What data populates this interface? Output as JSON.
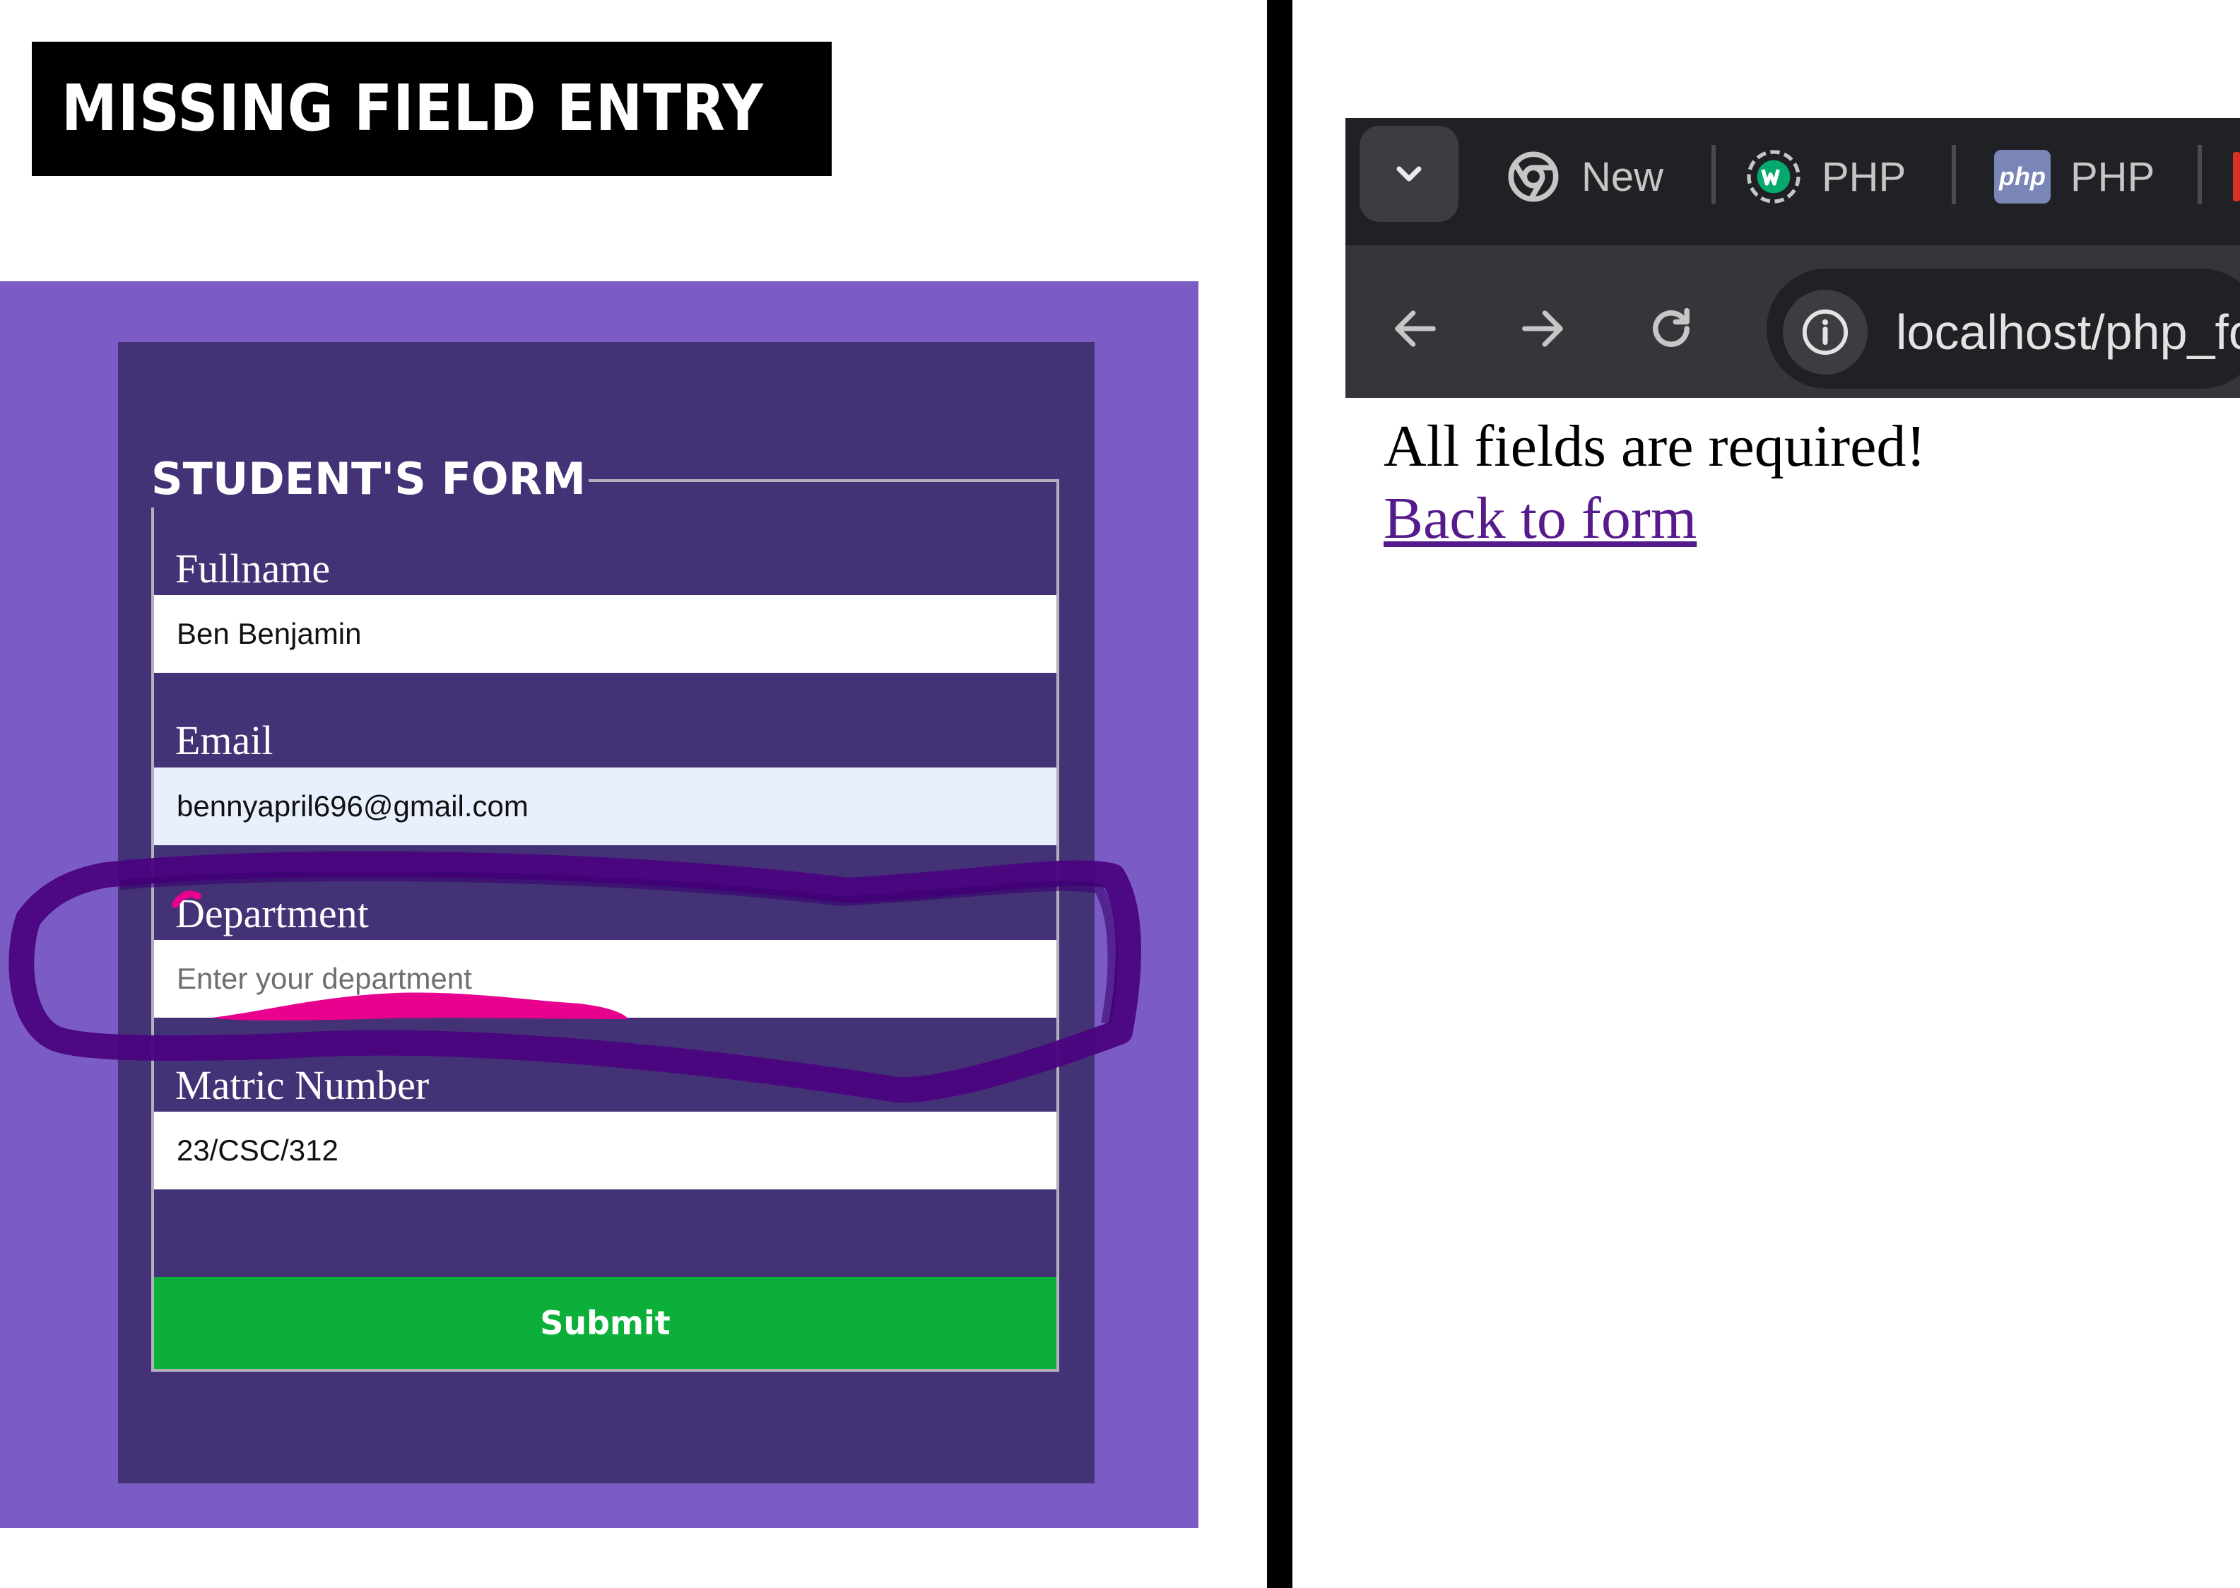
{
  "heading": {
    "title": "MISSING FIELD ENTRY"
  },
  "form": {
    "legend": "STUDENT'S FORM",
    "fields": [
      {
        "label": "Fullname",
        "value": "Ben Benjamin"
      },
      {
        "label": "Email",
        "value": "bennyapril696@gmail.com"
      },
      {
        "label": "Department",
        "value": "",
        "placeholder": "Enter your department"
      },
      {
        "label": "Matric Number",
        "value": "23/CSC/312"
      }
    ],
    "submit_label": "Submit"
  },
  "browser": {
    "tabs": [
      {
        "icon": "chrome-icon",
        "label": "New"
      },
      {
        "icon": "w3schools-icon",
        "label": "PHP"
      },
      {
        "icon": "php-icon",
        "label": "PHP",
        "icon_text": "php"
      }
    ],
    "url": "localhost/php_fo"
  },
  "result": {
    "message": "All fields are required!",
    "link": "Back to form"
  },
  "colors": {
    "outer_purple": "#7b5cc4",
    "form_purple": "#433276",
    "submit_green": "#0caf3a",
    "annotation_stroke": "#4a0480",
    "annotation_underline": "#e8008f",
    "link_visited": "#551a8b"
  }
}
